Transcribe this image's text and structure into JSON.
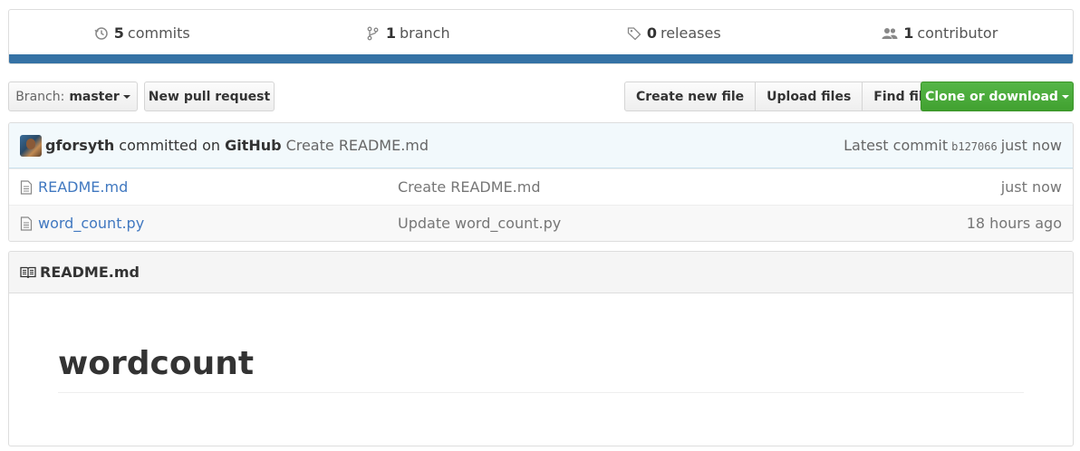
{
  "summary": {
    "commits": {
      "count": "5",
      "label": "commits"
    },
    "branches": {
      "count": "1",
      "label": "branch"
    },
    "releases": {
      "count": "0",
      "label": "releases"
    },
    "contributors": {
      "count": "1",
      "label": "contributor"
    },
    "language_bar_color": "#3572A5"
  },
  "toolbar": {
    "branch_prefix": "Branch:",
    "branch_name": "master",
    "new_pull_request": "New pull request",
    "create_new_file": "Create new file",
    "upload_files": "Upload files",
    "find_file": "Find file",
    "clone_or_download": "Clone or download"
  },
  "latest_commit": {
    "author": "gforsyth",
    "verb": "committed on",
    "committer": "GitHub",
    "message": "Create README.md",
    "label": "Latest commit",
    "sha": "b127066",
    "age": "just now"
  },
  "files": [
    {
      "name": "README.md",
      "message": "Create README.md",
      "age": "just now",
      "icon": "file-text-icon"
    },
    {
      "name": "word_count.py",
      "message": "Update word_count.py",
      "age": "18 hours ago",
      "icon": "file-text-icon"
    }
  ],
  "readme": {
    "filename": "README.md",
    "heading": "wordcount"
  },
  "colors": {
    "link": "#4078c0",
    "clone_button": "#41a130",
    "commit_tease_bg": "#f2f9fc"
  }
}
